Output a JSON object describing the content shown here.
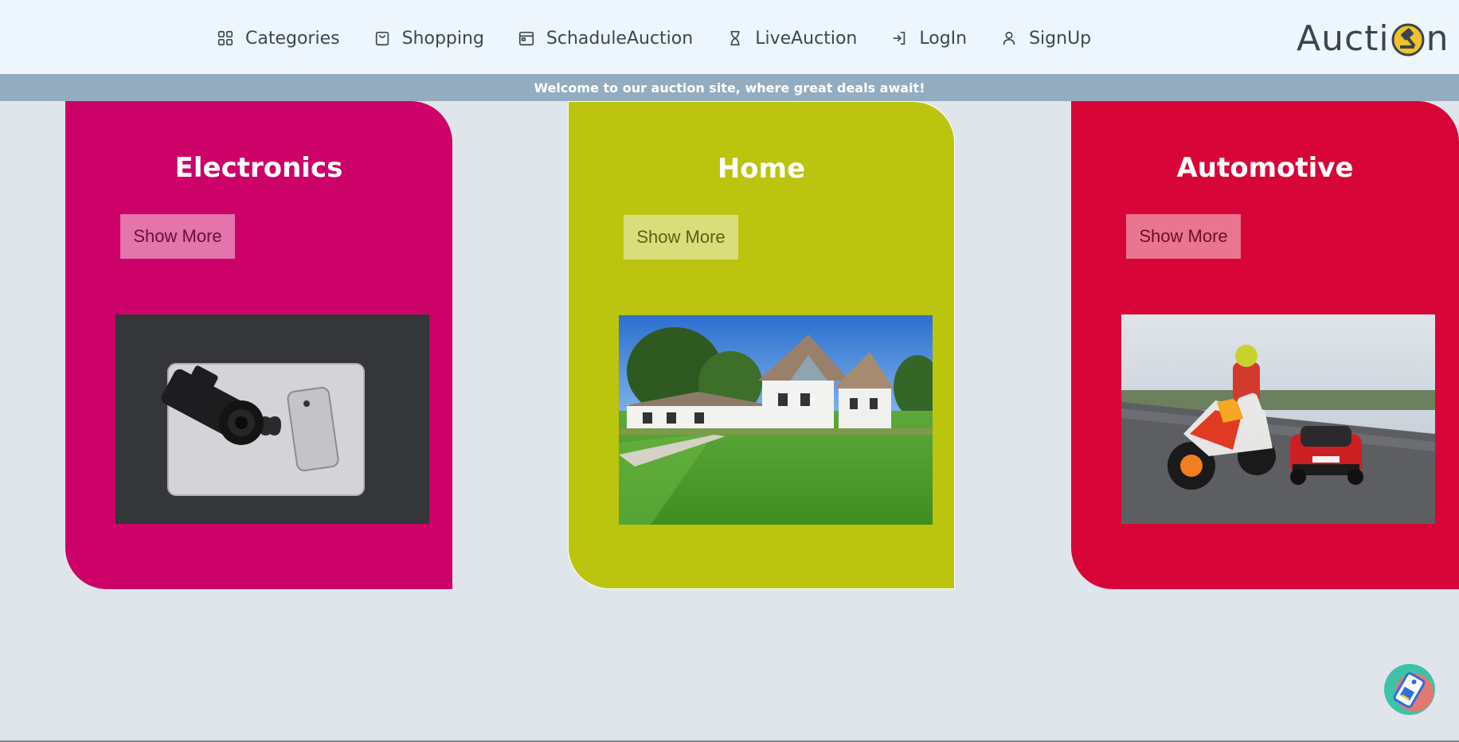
{
  "nav": {
    "items": [
      {
        "label": "Categories",
        "icon": "grid-icon"
      },
      {
        "label": "Shopping",
        "icon": "shopping-bag-icon"
      },
      {
        "label": "SchaduleAuction",
        "icon": "calendar-icon"
      },
      {
        "label": "LiveAuction",
        "icon": "hourglass-icon"
      },
      {
        "label": "LogIn",
        "icon": "login-icon"
      },
      {
        "label": "SignUp",
        "icon": "user-icon"
      }
    ],
    "brand": {
      "part1": "Aucti",
      "part2": "n",
      "logo_icon": "gavel-icon"
    }
  },
  "banner": {
    "text": "Welcome to our auction site, where great deals await!"
  },
  "cards": [
    {
      "title": "Electronics",
      "button": "Show More",
      "color": "#cc0268",
      "button_text_color": "#6b0d3b",
      "image": "camera-laptop-phone-image"
    },
    {
      "title": "Home",
      "button": "Show More",
      "color": "#bbc40f",
      "button_text_color": "#5a5f12",
      "image": "house-lawn-image"
    },
    {
      "title": "Automotive",
      "button": "Show More",
      "color": "#d80538",
      "button_text_color": "#6a1025",
      "image": "motorcycle-car-track-image"
    }
  ],
  "widget": {
    "icon": "price-tag-icon"
  },
  "colors": {
    "navbar_bg": "#eef6fd",
    "banner_bg": "#93acbf",
    "page_bg": "#dfe5ea",
    "brand_accent": "#f1c32a"
  }
}
